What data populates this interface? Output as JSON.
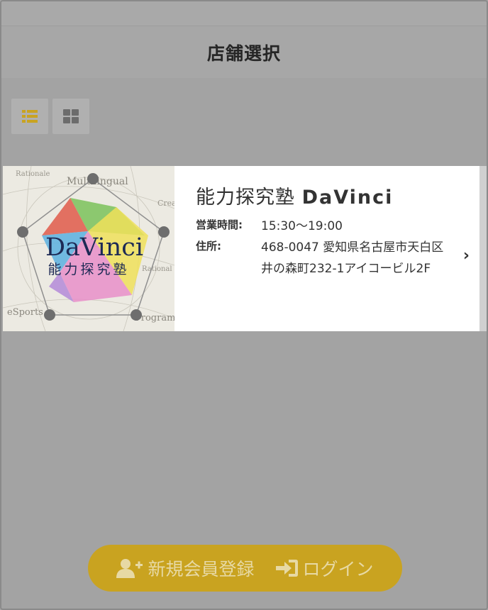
{
  "header": {
    "title": "店舗選択"
  },
  "view_toggle": {
    "active": "list",
    "icons": [
      "list-view-icon",
      "grid-view-icon"
    ]
  },
  "store": {
    "name_prefix": "能力探究塾",
    "name_brand": "DaVinci",
    "hours_label": "営業時間:",
    "hours_value": "15:30～19:00",
    "address_label": "住所:",
    "address_line1": "468-0047 愛知県名古屋市天白区",
    "address_line2": "井の森町232-1アイコービル2F",
    "logo": {
      "title": "DaVinci",
      "subtitle": "能力探究塾",
      "words": [
        "Multilingual",
        "eSports",
        "Program",
        "Creati",
        "Rational"
      ]
    }
  },
  "actions": {
    "register_label": "新規会員登録",
    "login_label": "ログイン"
  },
  "colors": {
    "accent": "#c9a320",
    "overlay": "#a4a4a4",
    "card": "#ffffff"
  }
}
